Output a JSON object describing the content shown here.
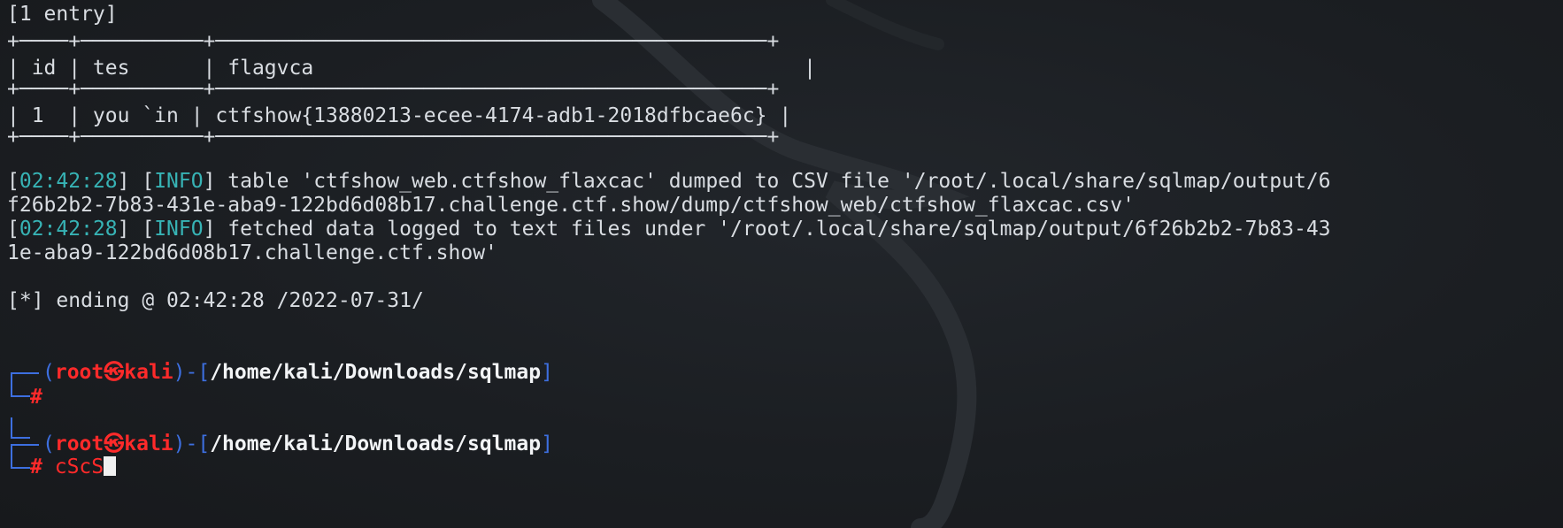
{
  "header": {
    "entry_count": "[1 entry]"
  },
  "table": {
    "border_top": "+────+──────────+─────────────────────────────────────────────+",
    "header_row": "| id | tes      | flagvca                                        |",
    "border_mid": "+────+──────────+─────────────────────────────────────────────+",
    "data_row": "| 1  | you `in | ctfshow{13880213-ecee-4174-adb1-2018dfbcae6c} |",
    "border_bottom": "+────+──────────+─────────────────────────────────────────────+"
  },
  "log": {
    "line1_time": "02:42:28",
    "line1_level": "INFO",
    "line1_msg": " table 'ctfshow_web.ctfshow_flaxcac' dumped to CSV file '/root/.local/share/sqlmap/output/6",
    "line1_cont": "f26b2b2-7b83-431e-aba9-122bd6d08b17.challenge.ctf.show/dump/ctfshow_web/ctfshow_flaxcac.csv'",
    "line2_time": "02:42:28",
    "line2_level": "INFO",
    "line2_msg": " fetched data logged to text files under '/root/.local/share/sqlmap/output/6f26b2b2-7b83-43",
    "line2_cont": "1e-aba9-122bd6d08b17.challenge.ctf.show'",
    "ending": "[*] ending @ 02:42:28 /2022-07-31/"
  },
  "prompts": [
    {
      "user": "root",
      "at": "㉿",
      "host": "kali",
      "path": "/home/kali/Downloads/sqlmap",
      "hash": "#",
      "command": ""
    },
    {
      "user": "root",
      "at": "㉿",
      "host": "kali",
      "path": "/home/kali/Downloads/sqlmap",
      "hash": "#",
      "command": "cScS"
    }
  ],
  "colors": {
    "background": "#1b1e22",
    "text": "#d9dde2",
    "info_cyan": "#37b3b5",
    "prompt_blue": "#3d6fe0",
    "prompt_red": "#ff2a2a"
  }
}
